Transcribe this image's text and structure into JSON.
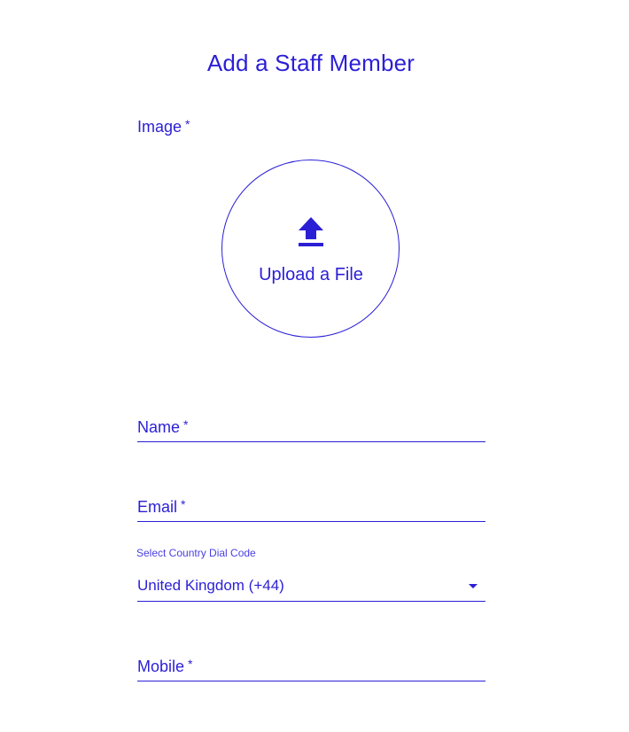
{
  "form": {
    "title": "Add a Staff Member",
    "image": {
      "label": "Image",
      "required_mark": "*",
      "upload_text": "Upload a File",
      "icon": "upload-icon"
    },
    "name": {
      "label": "Name",
      "required_mark": "*",
      "value": ""
    },
    "email": {
      "label": "Email",
      "required_mark": "*",
      "value": ""
    },
    "dial_code": {
      "caption": "Select Country Dial Code",
      "selected": "United Kingdom (+44)",
      "icon": "caret-down-icon"
    },
    "mobile": {
      "label": "Mobile",
      "required_mark": "*",
      "value": ""
    }
  },
  "colors": {
    "accent": "#2b1fd6",
    "background": "#ffffff"
  }
}
